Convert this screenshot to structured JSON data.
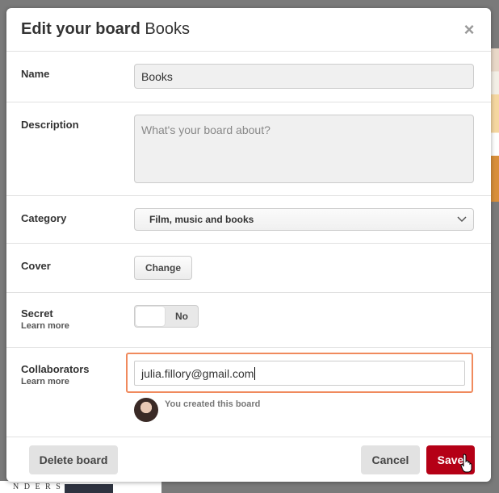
{
  "dialog": {
    "title_bold": "Edit your board",
    "title_rest": " Books",
    "close_icon": "×"
  },
  "fields": {
    "name": {
      "label": "Name",
      "value": "Books"
    },
    "description": {
      "label": "Description",
      "placeholder": "What's your board about?"
    },
    "category": {
      "label": "Category",
      "value": "Film, music and books"
    },
    "cover": {
      "label": "Cover",
      "button_label": "Change"
    },
    "secret": {
      "label": "Secret",
      "learn_more": "Learn more",
      "toggle_value": "No"
    },
    "collaborators": {
      "label": "Collaborators",
      "learn_more": "Learn more",
      "value": "julia.fillory@gmail.com",
      "created_text": "You created this board"
    }
  },
  "footer": {
    "delete_label": "Delete board",
    "cancel_label": "Cancel",
    "save_label": "Save"
  },
  "background": {
    "partial_text": "N D E R S"
  },
  "colors": {
    "save_button": "#b50016",
    "highlight": "#f08a5d",
    "overlay": "#7a7a7a"
  }
}
